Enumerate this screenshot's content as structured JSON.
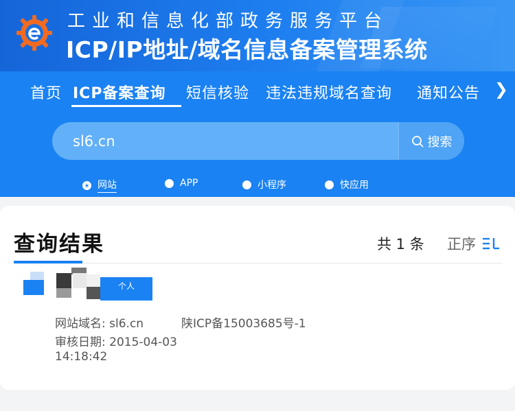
{
  "header": {
    "subtitle": "工业和信息化部政务服务平台",
    "title": "ICP/IP地址/域名信息备案管理系统"
  },
  "nav": {
    "items": [
      {
        "label": "首页",
        "active": false
      },
      {
        "label": "ICP备案查询",
        "active": true
      },
      {
        "label": "短信核验",
        "active": false
      },
      {
        "label": "违法违规域名查询",
        "active": false
      },
      {
        "label": "通知公告",
        "active": false
      }
    ],
    "more_icon": "chevron-right-icon"
  },
  "search": {
    "value": "sl6.cn",
    "button_label": "搜索"
  },
  "filters": [
    {
      "label": "网站",
      "selected": true
    },
    {
      "label": "APP",
      "selected": false
    },
    {
      "label": "小程序",
      "selected": false
    },
    {
      "label": "快应用",
      "selected": false
    }
  ],
  "results": {
    "title": "查询结果",
    "count_text": "共 1 条",
    "sort_label": "正序",
    "item": {
      "tag": "个人",
      "domain_label": "网站域名:",
      "domain_value": "sl6.cn",
      "icp_number": "陕ICP备15003685号-1",
      "date_label": "审核日期:",
      "date_value": "2015-04-03",
      "time_value": "14:18:42"
    }
  },
  "colors": {
    "primary": "#1a82f2",
    "header_dark": "#1565d8",
    "search_bg": "#62b0f8"
  }
}
